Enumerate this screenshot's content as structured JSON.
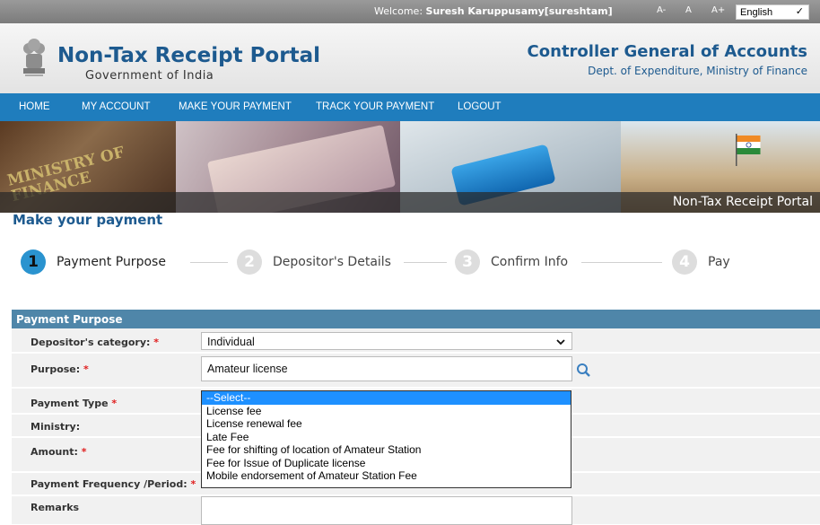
{
  "topbar": {
    "welcome_prefix": "Welcome: ",
    "welcome_user": "Suresh Karuppusamy[sureshtam]",
    "font_small": "A-",
    "font_normal": "A",
    "font_large": "A+",
    "language": "English"
  },
  "header": {
    "portal_title": "Non-Tax Receipt Portal",
    "portal_subtitle": "Government of India",
    "org_title": "Controller General of Accounts",
    "org_subtitle": "Dept. of Expenditure, Ministry of Finance"
  },
  "nav": {
    "items": [
      "HOME",
      "MY ACCOUNT",
      "MAKE YOUR PAYMENT",
      "TRACK YOUR PAYMENT",
      "LOGOUT"
    ]
  },
  "banner": {
    "sign_text": "MINISTRY OF FINANCE",
    "label": "Non-Tax Receipt Portal"
  },
  "page": {
    "title": "Make your payment"
  },
  "steps": [
    {
      "num": "1",
      "label": "Payment Purpose"
    },
    {
      "num": "2",
      "label": "Depositor's Details"
    },
    {
      "num": "3",
      "label": "Confirm Info"
    },
    {
      "num": "4",
      "label": "Pay"
    }
  ],
  "form": {
    "section_title": "Payment Purpose",
    "required_mark": "*",
    "depositor_category": {
      "label": "Depositor's category:",
      "value": "Individual"
    },
    "purpose": {
      "label": "Purpose:",
      "value": "Amateur license"
    },
    "payment_type": {
      "label": "Payment Type",
      "options": [
        "--Select--",
        "License fee",
        "License renewal fee",
        "Late Fee",
        "Fee for shifting of location of Amateur Station",
        "Fee for Issue of Duplicate license",
        "Mobile endorsement of Amateur Station Fee"
      ]
    },
    "ministry": {
      "label": "Ministry:"
    },
    "amount": {
      "label": "Amount:"
    },
    "frequency": {
      "label": "Payment Frequency /Period:"
    },
    "remarks": {
      "label": "Remarks"
    }
  },
  "colors": {
    "nav_blue": "#1f7dbd",
    "title_blue": "#1d5a8f",
    "panel_head": "#4f86a9",
    "step_active": "#2a93cf",
    "required_red": "#e02020",
    "selected_option": "#1e90ff"
  }
}
